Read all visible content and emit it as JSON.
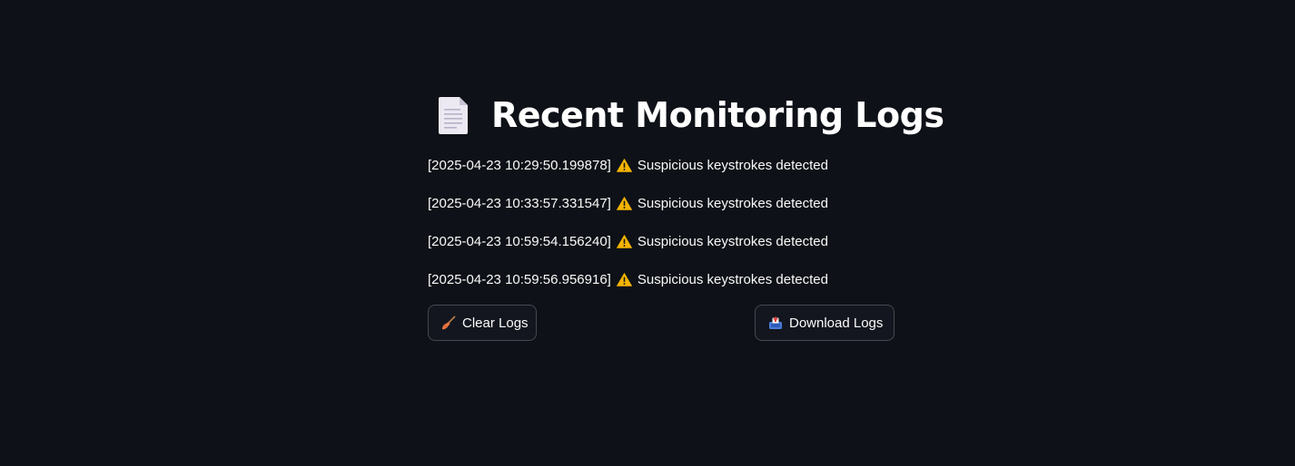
{
  "header": {
    "title": "Recent Monitoring Logs",
    "icon": "page-facing-up-icon"
  },
  "logs": [
    {
      "timestamp": "[2025-04-23 10:29:50.199878]",
      "icon": "warning-icon",
      "message": "Suspicious keystrokes detected"
    },
    {
      "timestamp": "[2025-04-23 10:33:57.331547]",
      "icon": "warning-icon",
      "message": "Suspicious keystrokes detected"
    },
    {
      "timestamp": "[2025-04-23 10:59:54.156240]",
      "icon": "warning-icon",
      "message": "Suspicious keystrokes detected"
    },
    {
      "timestamp": "[2025-04-23 10:59:56.956916]",
      "icon": "warning-icon",
      "message": "Suspicious keystrokes detected"
    }
  ],
  "actions": {
    "clear": {
      "label": "Clear Logs",
      "icon": "broom-icon"
    },
    "download": {
      "label": "Download Logs",
      "icon": "outbox-tray-icon"
    }
  },
  "colors": {
    "background": "#0e1117",
    "text": "#fafafa",
    "warning": "#f4b400"
  }
}
